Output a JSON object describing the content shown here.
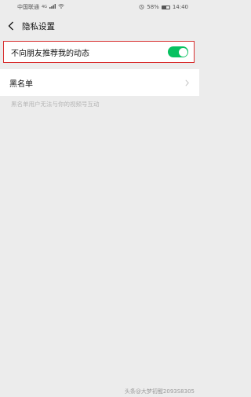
{
  "status_bar": {
    "carrier": "中国联通",
    "signal": "4G",
    "battery": "58%",
    "time": "14:40"
  },
  "nav": {
    "title": "隐私设置"
  },
  "settings": {
    "recommend_label": "不向朋友推荐我的动态",
    "recommend_enabled": true,
    "blacklist_label": "黑名单",
    "blacklist_hint": "黑名单用户无法与你的视频号互动"
  },
  "watermark": "头条@大梦初醒2093S8305",
  "colors": {
    "toggle_on": "#07c160",
    "highlight_border": "#d82e2e"
  },
  "icons": [
    "back-icon",
    "chevron-right-icon",
    "wifi-icon",
    "alarm-icon",
    "battery-icon"
  ]
}
